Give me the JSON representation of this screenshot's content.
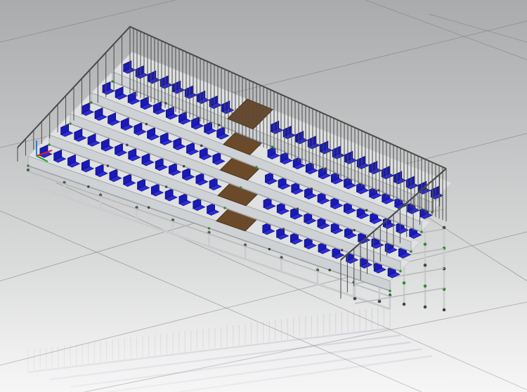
{
  "viewport": {
    "background_top": "#a9abac",
    "background_bottom": "#f2f2f2",
    "grid_color": "#7f8081"
  },
  "grandstand": {
    "rows": 5,
    "seats_per_section": [
      12,
      12,
      12,
      12,
      12
    ],
    "aisle_count": 1,
    "seat_color": "#1a1ab8",
    "seat_shadow_color": "#0c0c6e",
    "deck_color": "#6b4a2a",
    "frame_color": "#c9ccce",
    "railing_color": "#4a4a4a",
    "connector_color": "#2f8f2f"
  },
  "axis_gizmo": {
    "x_color": "#e02020",
    "y_color": "#20a020",
    "z_color": "#2080e0"
  }
}
